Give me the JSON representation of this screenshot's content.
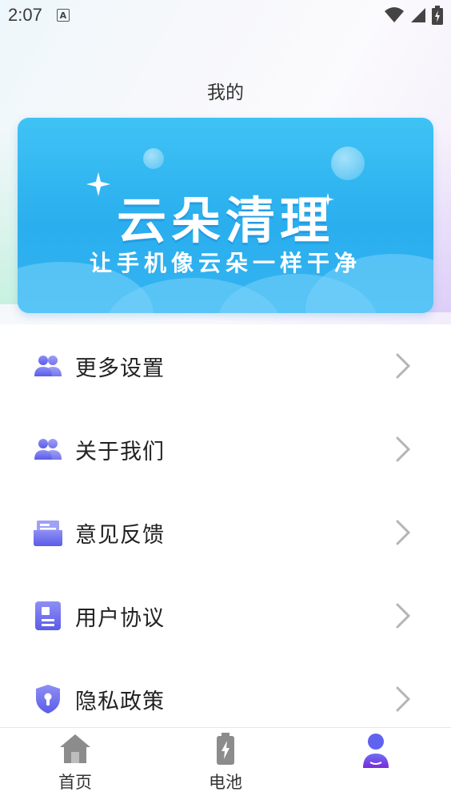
{
  "status_bar": {
    "time": "2:07",
    "notification_badge": "A",
    "icons": [
      "wifi-icon",
      "signal-icon",
      "battery-charging-icon"
    ]
  },
  "header": {
    "title": "我的"
  },
  "banner": {
    "title": "云朵清理",
    "subtitle": "让手机像云朵一样干净"
  },
  "menu": {
    "items": [
      {
        "label": "更多设置",
        "icon": "users-icon"
      },
      {
        "label": "关于我们",
        "icon": "users-icon"
      },
      {
        "label": "意见反馈",
        "icon": "inbox-icon"
      },
      {
        "label": "用户协议",
        "icon": "document-icon"
      },
      {
        "label": "隐私政策",
        "icon": "shield-lock-icon"
      }
    ]
  },
  "bottom_nav": {
    "items": [
      {
        "label": "首页",
        "icon": "home-icon"
      },
      {
        "label": "电池",
        "icon": "battery-icon"
      },
      {
        "label": "",
        "icon": "user-icon",
        "active": true
      }
    ]
  },
  "colors": {
    "accent": "#6b6ef0",
    "banner": "#2aaeee",
    "chevron": "#b5b5b5"
  }
}
